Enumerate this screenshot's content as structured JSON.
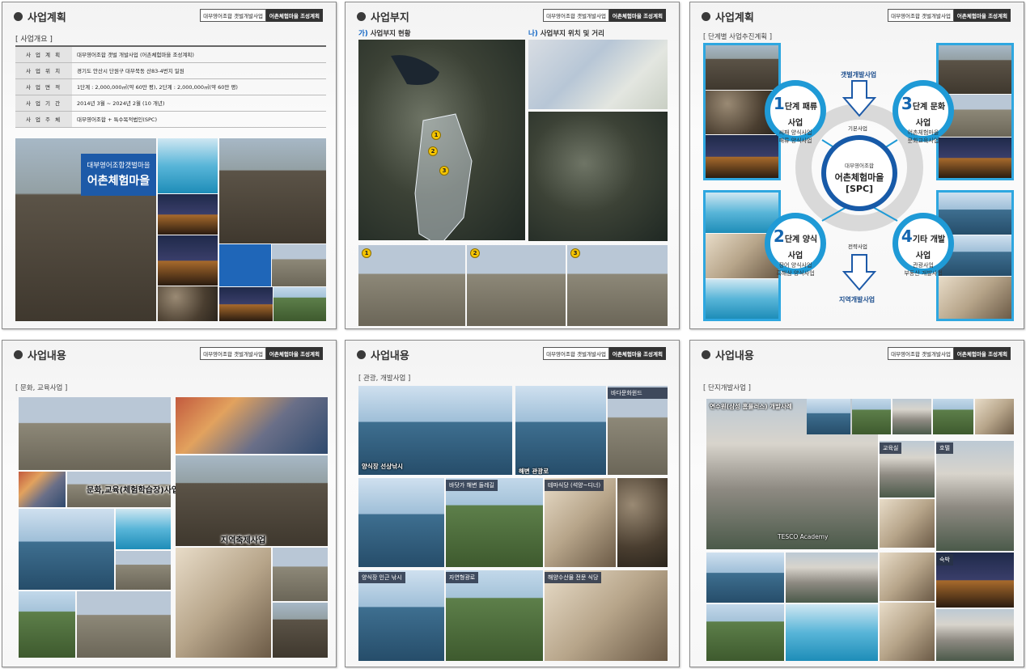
{
  "common": {
    "tag_left": "대부영어조합 갯벌개발사업",
    "tag_right": "어촌체험마을 조성계획"
  },
  "slide1": {
    "title": "사업계획",
    "section": "[ 사업개요 ]",
    "rows": [
      {
        "key": "사 업 계 획",
        "val": "대부영어조합 갯벌 개발사업 (어촌체험마을 조성계획)"
      },
      {
        "key": "사 업 위 치",
        "val": "경기도 안산시 단원구 대부북동 산83-4번지 일원"
      },
      {
        "key": "사 업 면 적",
        "val": "1단계 : 2,000,000㎡(약 60만 평), 2단계 : 2,000,000㎡(약 60만 평)"
      },
      {
        "key": "사 업 기 간",
        "val": "2014년 3월 ~ 2024년 2월 (10 개년)"
      },
      {
        "key": "사 업 주 체",
        "val": "대부영어조합 + 특수목적법인(SPC)"
      }
    ],
    "banner_line1": "대부영어조합갯벌마을",
    "banner_line2": "어촌체험마을"
  },
  "slide2": {
    "title": "사업부지",
    "map1_key": "가)",
    "map1_label": "사업부지 현황",
    "map2_key": "나)",
    "map2_label": "사업부지 위치 및 거리",
    "pins": [
      "1",
      "2",
      "3"
    ]
  },
  "slide3": {
    "title": "사업계획",
    "section": "[ 단계별 사업추진계획 ]",
    "top_label": "갯벌개발사업",
    "base_label": "기본사업",
    "strategy_label": "전략사업",
    "bottom_label": "지역개발사업",
    "center": {
      "line1": "대부영어조합",
      "line2": "어촌체험마을",
      "line3": "[SPC]"
    },
    "c1": {
      "num": "1",
      "head": "단계 패류사업",
      "body1": "씨패 양식사업",
      "body2": "패류 양식사업"
    },
    "c2": {
      "num": "2",
      "head": "단계 양식사업",
      "body1": "장어 양식사업",
      "body2": "흑해삼 양식사업"
    },
    "c3": {
      "num": "3",
      "head": "단계 문화사업",
      "body1": "어촌체험마을",
      "body2": "문화교육사업"
    },
    "c4": {
      "num": "4",
      "head": "기타 개발사업",
      "body1": "관광사업",
      "body2": "부동산 개발사업"
    }
  },
  "slide4": {
    "title": "사업내용",
    "section": "[ 문화, 교육사업 ]",
    "caption1": "문화,교육(체험학습장)사업",
    "caption2": "지역축제사업"
  },
  "slide5": {
    "title": "사업내용",
    "section": "[ 관광, 개발사업 ]",
    "captions": [
      "양식장 선상낚시",
      "해변 관광로",
      "바다문화윈드",
      "바닷가 해변 둘레길",
      "테마식당 (석양~디너)",
      "양식장 인근 낚시",
      "자연형광로",
      "해양수산물 전문 식당"
    ]
  },
  "slide6": {
    "title": "사업내용",
    "section": "[ 단지개발사업 ]",
    "caption_main": "연수원(삼성 홈플러스) 개발사례",
    "caption_academy": "TESCO Academy",
    "caption_edu": "교육실",
    "caption_hotel": "호텔",
    "caption_stay": "숙박"
  }
}
